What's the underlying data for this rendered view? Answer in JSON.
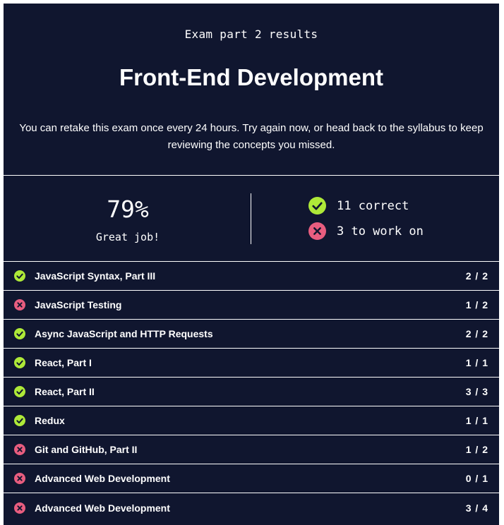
{
  "header": {
    "eyebrow": "Exam part 2 results",
    "title": "Front-End Development",
    "description": "You can retake this exam once every 24 hours. Try again now, or head back to the syllabus to keep reviewing the concepts you missed."
  },
  "summary": {
    "percent": "79%",
    "message": "Great job!",
    "correct_label": "11 correct",
    "wrong_label": "3 to work on"
  },
  "colors": {
    "background": "#10162f",
    "correct": "#aee938",
    "wrong": "#e85d7f",
    "text": "#ffffff"
  },
  "topics": [
    {
      "name": "JavaScript Syntax, Part III",
      "score": "2 / 2",
      "status": "correct"
    },
    {
      "name": "JavaScript Testing",
      "score": "1 / 2",
      "status": "wrong"
    },
    {
      "name": "Async JavaScript and HTTP Requests",
      "score": "2 / 2",
      "status": "correct"
    },
    {
      "name": "React, Part I",
      "score": "1 / 1",
      "status": "correct"
    },
    {
      "name": "React, Part II",
      "score": "3 / 3",
      "status": "correct"
    },
    {
      "name": "Redux",
      "score": "1 / 1",
      "status": "correct"
    },
    {
      "name": "Git and GitHub, Part II",
      "score": "1 / 2",
      "status": "wrong"
    },
    {
      "name": "Advanced Web Development",
      "score": "0 / 1",
      "status": "wrong"
    },
    {
      "name": "Advanced Web Development",
      "score": "3 / 4",
      "status": "wrong"
    }
  ]
}
